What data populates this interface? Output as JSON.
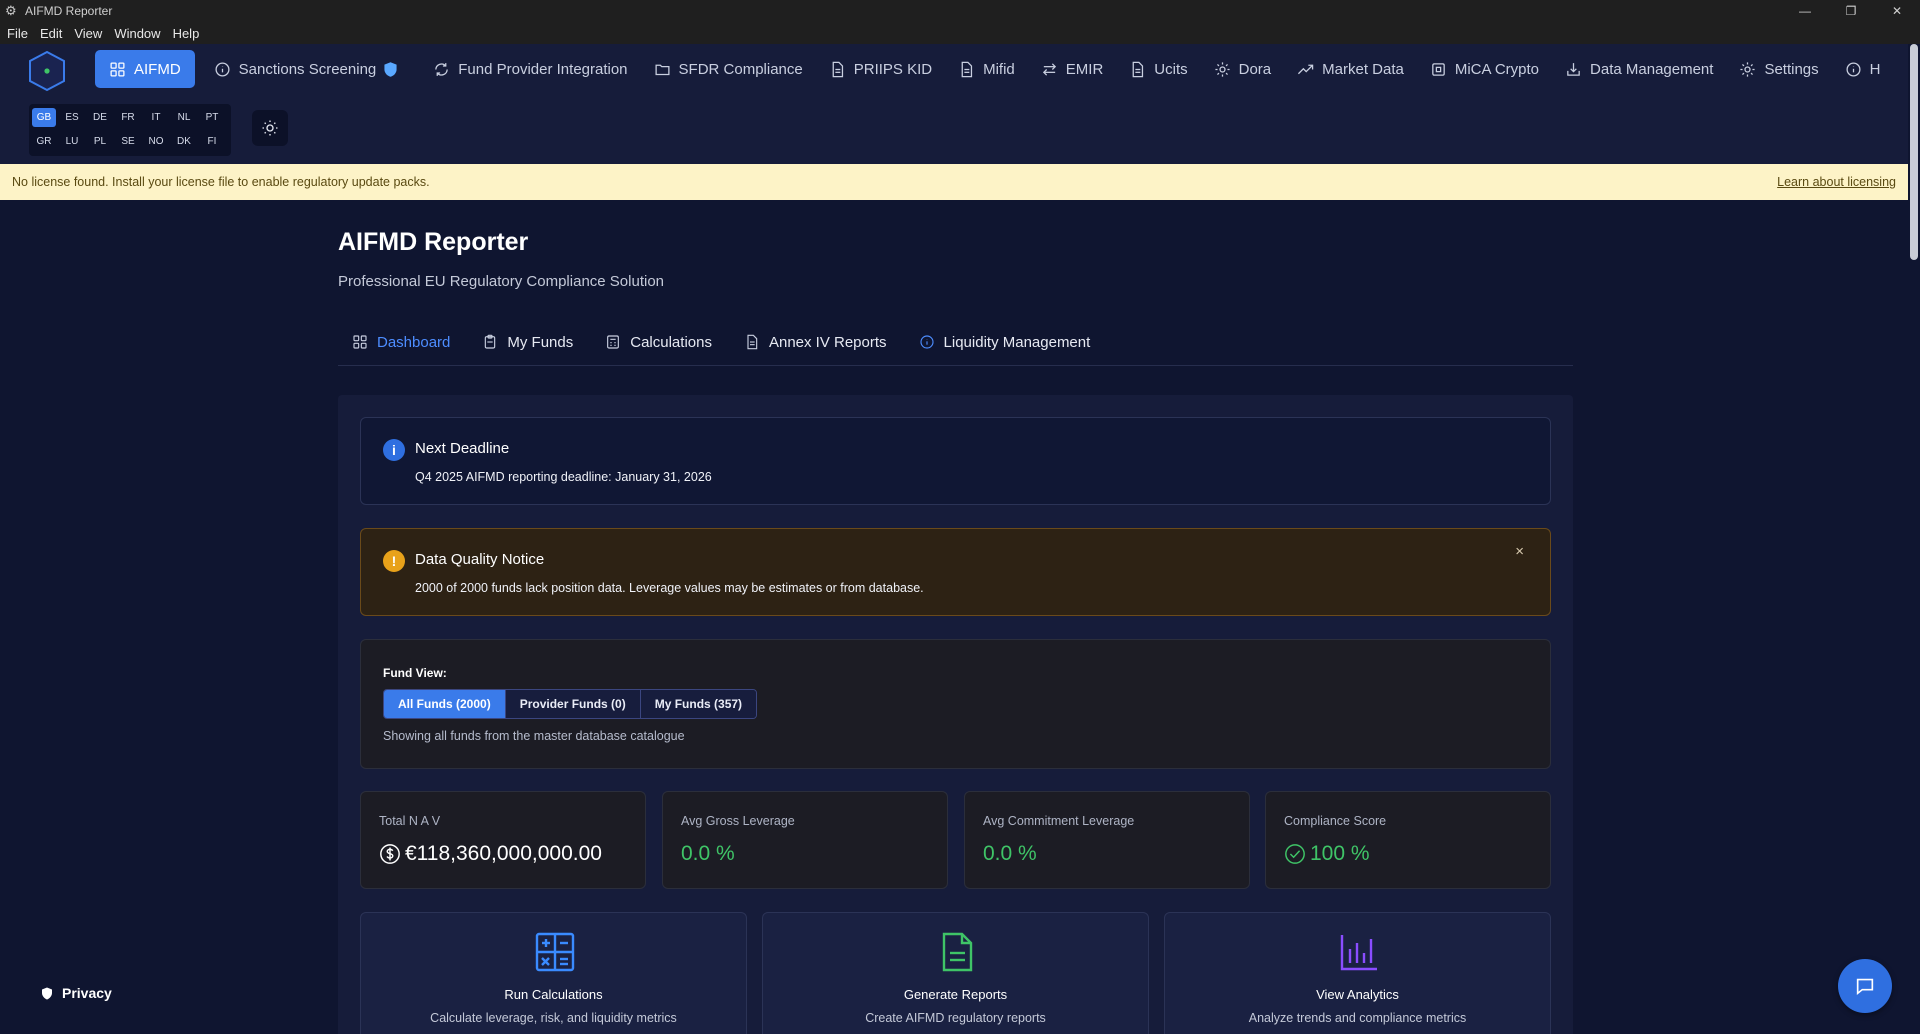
{
  "window": {
    "title": "AIFMD Reporter"
  },
  "menu": [
    "File",
    "Edit",
    "View",
    "Window",
    "Help"
  ],
  "nav": [
    {
      "label": "AIFMD",
      "icon": "grid-icon",
      "active": true
    },
    {
      "label": "Sanctions Screening",
      "icon": "info-circle-icon",
      "badge": "shield-icon"
    },
    {
      "label": "Fund Provider Integration",
      "icon": "sync-icon"
    },
    {
      "label": "SFDR Compliance",
      "icon": "folder-icon"
    },
    {
      "label": "PRIIPS KID",
      "icon": "document-icon"
    },
    {
      "label": "Mifid",
      "icon": "document-icon"
    },
    {
      "label": "EMIR",
      "icon": "arrows-icon"
    },
    {
      "label": "Ucits",
      "icon": "document-icon"
    },
    {
      "label": "Dora",
      "icon": "gear-icon"
    },
    {
      "label": "Market Data",
      "icon": "trend-icon"
    },
    {
      "label": "MiCA Crypto",
      "icon": "chip-icon"
    },
    {
      "label": "Data Management",
      "icon": "database-icon"
    },
    {
      "label": "Settings",
      "icon": "gear-icon"
    },
    {
      "label": "H",
      "icon": "info-circle-icon"
    }
  ],
  "languages": {
    "row1": [
      "GB",
      "ES",
      "DE",
      "FR",
      "IT",
      "NL",
      "PT"
    ],
    "row2": [
      "GR",
      "LU",
      "PL",
      "SE",
      "NO",
      "DK",
      "FI"
    ],
    "active": "GB"
  },
  "banner": {
    "message": "No license found. Install your license file to enable regulatory update packs.",
    "link": "Learn about licensing"
  },
  "page": {
    "title": "AIFMD Reporter",
    "subtitle": "Professional EU Regulatory Compliance Solution"
  },
  "tabs": [
    {
      "label": "Dashboard",
      "icon": "grid-icon",
      "active": true
    },
    {
      "label": "My Funds",
      "icon": "clipboard-icon"
    },
    {
      "label": "Calculations",
      "icon": "calculator-icon"
    },
    {
      "label": "Annex IV Reports",
      "icon": "document-icon"
    },
    {
      "label": "Liquidity Management",
      "icon": "droplet-icon"
    }
  ],
  "deadline": {
    "title": "Next Deadline",
    "text": "Q4 2025 AIFMD reporting deadline: January 31, 2026",
    "color": "#2f6fe0"
  },
  "data_quality": {
    "title": "Data Quality Notice",
    "text": "2000 of 2000 funds lack position data. Leverage values may be estimates or from database.",
    "close": "×",
    "color": "#e8a21a"
  },
  "fund_view": {
    "label": "Fund View:",
    "options": [
      "All Funds (2000)",
      "Provider Funds (0)",
      "My Funds (357)"
    ],
    "active_index": 0,
    "help": "Showing all funds from the master database catalogue"
  },
  "stats": [
    {
      "label": "Total N A V",
      "value": "€118,360,000,000.00",
      "icon": "dollar-circle-icon",
      "color": "#ffffff"
    },
    {
      "label": "Avg Gross Leverage",
      "value": "0.0 %",
      "color": "#3fc467"
    },
    {
      "label": "Avg Commitment Leverage",
      "value": "0.0 %",
      "color": "#3fc467"
    },
    {
      "label": "Compliance Score",
      "value": "100 %",
      "icon": "check-circle-icon",
      "color": "#3fc467"
    }
  ],
  "actions": [
    {
      "title": "Run Calculations",
      "desc": "Calculate leverage, risk, and liquidity metrics",
      "icon": "calculator-icon",
      "color": "#3a8bff"
    },
    {
      "title": "Generate Reports",
      "desc": "Create AIFMD regulatory reports",
      "icon": "document-icon",
      "color": "#3fc467"
    },
    {
      "title": "View Analytics",
      "desc": "Analyze trends and compliance metrics",
      "icon": "bar-chart-icon",
      "color": "#8a4dff"
    }
  ],
  "footer": {
    "privacy": "Privacy"
  }
}
